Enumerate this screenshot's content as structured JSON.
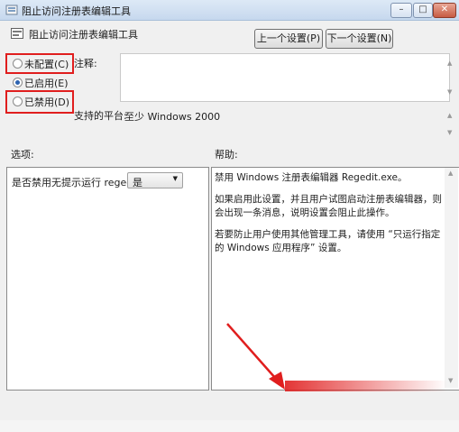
{
  "window": {
    "title": "阻止访问注册表编辑工具",
    "controls": [
      "minimize",
      "maximize",
      "close"
    ]
  },
  "header": {
    "policy_name": "阻止访问注册表编辑工具",
    "prev_button": "上一个设置(P)",
    "next_button": "下一个设置(N)"
  },
  "state_options": [
    {
      "label": "未配置(C)",
      "selected": false,
      "highlighted": true
    },
    {
      "label": "已启用(E)",
      "selected": true,
      "highlighted": false
    },
    {
      "label": "已禁用(D)",
      "selected": false,
      "highlighted": true
    }
  ],
  "comment": {
    "label": "注释:",
    "value": ""
  },
  "supported": {
    "label": "支持的平台:",
    "value": "至少 Windows 2000"
  },
  "options_section": {
    "label": "选项:",
    "question": "是否禁用无提示运行 regedit ?",
    "selected": "是"
  },
  "help_section": {
    "label": "帮助:",
    "paragraphs": [
      "禁用 Windows 注册表编辑器 Regedit.exe。",
      "如果启用此设置，并且用户试图启动注册表编辑器，则会出现一条消息，说明设置会阻止此操作。",
      "若要防止用户使用其他管理工具，请使用 “只运行指定的 Windows 应用程序” 设置。"
    ]
  },
  "annotation_colors": {
    "box": "#e01e1e",
    "arrow": "#e01e1e"
  }
}
